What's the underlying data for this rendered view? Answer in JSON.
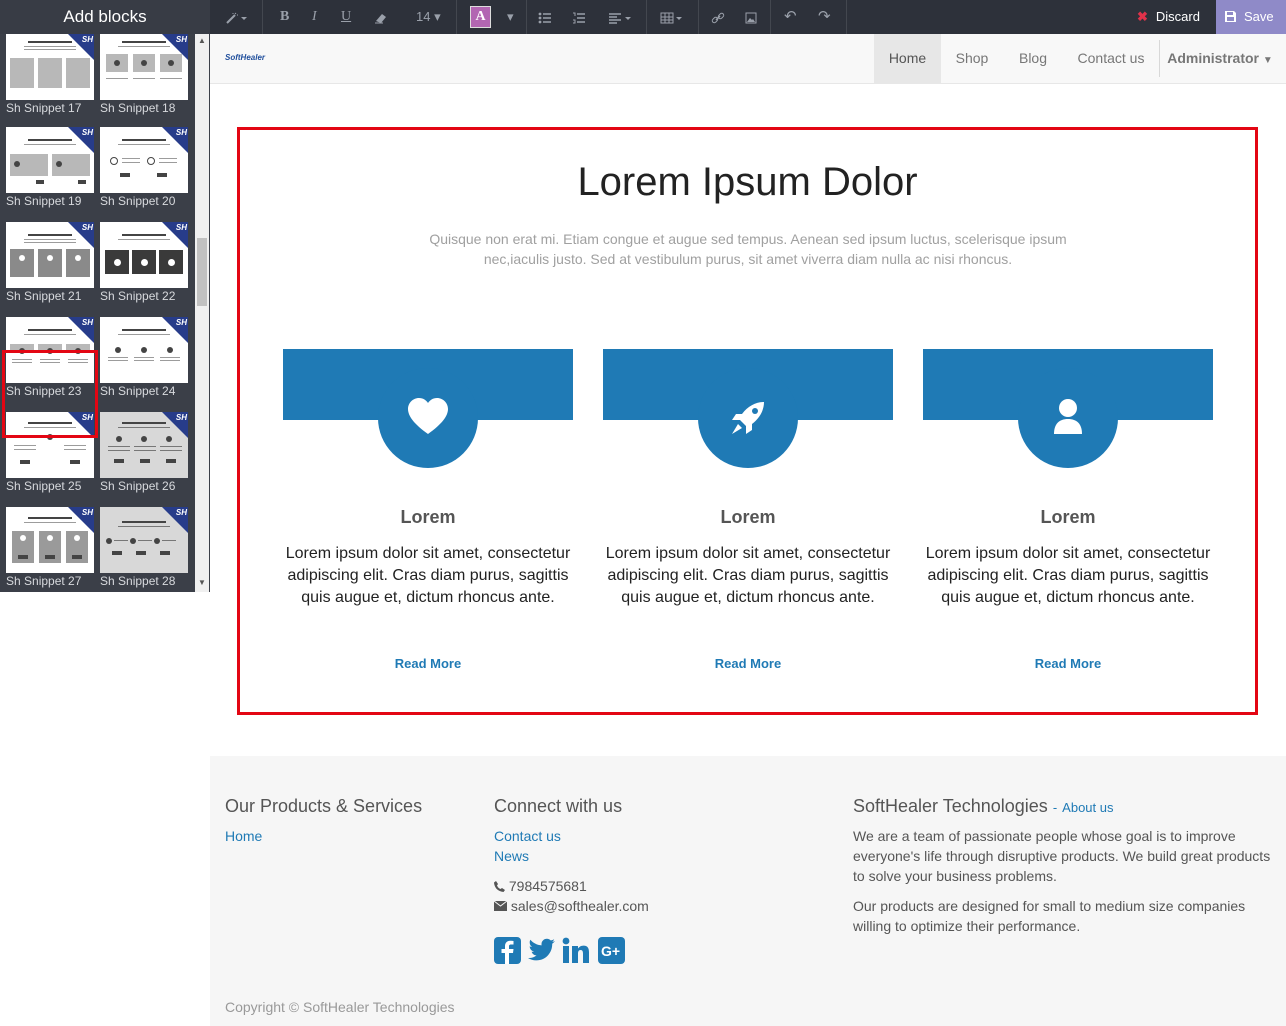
{
  "editor": {
    "panel_title": "Add blocks",
    "font_size": "14",
    "discard_label": "Discard",
    "save_label": "Save"
  },
  "snippets": [
    {
      "label": "Sh Snippet 17"
    },
    {
      "label": "Sh Snippet 18"
    },
    {
      "label": "Sh Snippet 19"
    },
    {
      "label": "Sh Snippet 20"
    },
    {
      "label": "Sh Snippet 21"
    },
    {
      "label": "Sh Snippet 22"
    },
    {
      "label": "Sh Snippet 23"
    },
    {
      "label": "Sh Snippet 24"
    },
    {
      "label": "Sh Snippet 25"
    },
    {
      "label": "Sh Snippet 26"
    },
    {
      "label": "Sh Snippet 27"
    },
    {
      "label": "Sh Snippet 28"
    }
  ],
  "snippet_badge": "SH",
  "navbar": {
    "logo": "SoftHealer",
    "items": [
      "Home",
      "Shop",
      "Blog",
      "Contact us"
    ],
    "user": "Administrator"
  },
  "hero": {
    "title": "Lorem Ipsum Dolor",
    "subtitle": "Quisque non erat mi. Etiam congue et augue sed tempus. Aenean sed ipsum luctus, scelerisque ipsum nec,iaculis justo. Sed at vestibulum purus, sit amet viverra diam nulla ac nisi rhoncus."
  },
  "cards": [
    {
      "icon": "heart-icon",
      "title": "Lorem",
      "text": "Lorem ipsum dolor sit amet, consectetur adipiscing elit. Cras diam purus, sagittis quis augue et, dictum rhoncus ante.",
      "link": "Read More"
    },
    {
      "icon": "rocket-icon",
      "title": "Lorem",
      "text": "Lorem ipsum dolor sit amet, consectetur adipiscing elit. Cras diam purus, sagittis quis augue et, dictum rhoncus ante.",
      "link": "Read More"
    },
    {
      "icon": "user-icon",
      "title": "Lorem",
      "text": "Lorem ipsum dolor sit amet, consectetur adipiscing elit. Cras diam purus, sagittis quis augue et, dictum rhoncus ante.",
      "link": "Read More"
    }
  ],
  "footer": {
    "products_heading": "Our Products & Services",
    "products_links": [
      "Home"
    ],
    "connect_heading": "Connect with us",
    "connect_links": [
      "Contact us",
      "News"
    ],
    "phone": "7984575681",
    "email": "sales@softhealer.com",
    "company_heading": "SoftHealer Technologies",
    "about_link": "About us",
    "about_sep": "-",
    "about_p1": "We are a team of passionate people whose goal is to improve everyone's life through disruptive products. We build great products to solve your business problems.",
    "about_p2": "Our products are designed for small to medium size companies willing to optimize their performance.",
    "copyright": "Copyright © SoftHealer Technologies"
  },
  "colors": {
    "accent": "#1f7ab5",
    "selection": "#e30613",
    "save": "#8f8ac8",
    "toolbar": "#2d313a"
  }
}
